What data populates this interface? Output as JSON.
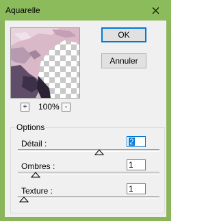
{
  "window": {
    "title": "Aquarelle"
  },
  "preview": {
    "zoom": "100%",
    "zoom_in": "+",
    "zoom_out": "-"
  },
  "buttons": {
    "ok": "OK",
    "cancel": "Annuler"
  },
  "options": {
    "group_label": "Options",
    "detail": {
      "label": "Détail :",
      "value": "2",
      "min": 1,
      "max": 2
    },
    "ombres": {
      "label": "Ombres :",
      "value": "1",
      "min": 0,
      "max": 3
    },
    "texture": {
      "label": "Texture :",
      "value": "1",
      "min": 1,
      "max": 3
    }
  },
  "colors": {
    "titlebar": "#8cbb5c",
    "accent": "#0078d7"
  }
}
